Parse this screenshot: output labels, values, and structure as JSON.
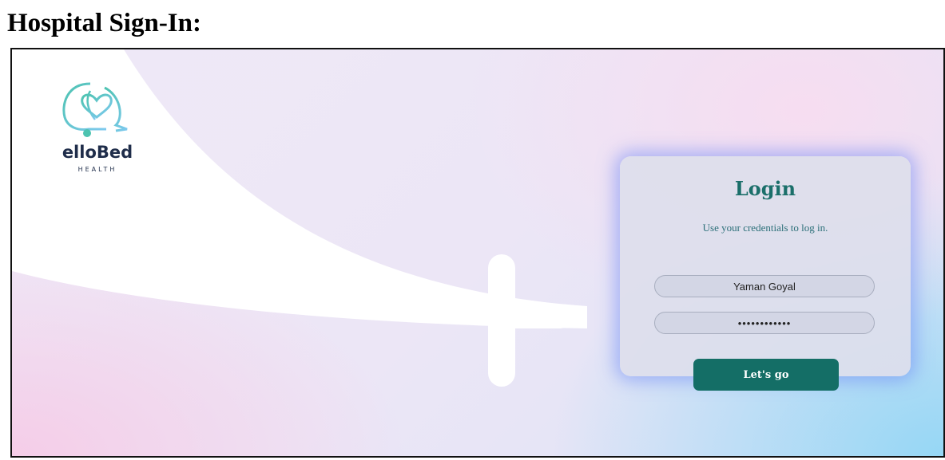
{
  "page": {
    "title": "Hospital Sign-In:"
  },
  "brand": {
    "name": "elloBed",
    "tagline": "HEALTH",
    "logo_icon": "stethoscope-heart-icon",
    "colors": {
      "teal": "#1b6f6a",
      "button": "#146e66",
      "logo_gradient_start": "#4dc3b0",
      "logo_gradient_end": "#7ec9ef"
    }
  },
  "login": {
    "title": "Login",
    "subtitle": "Use your credentials to log in.",
    "username_value": "Yaman Goyal",
    "password_value": "••••••••••••",
    "submit_label": "Let's go"
  }
}
